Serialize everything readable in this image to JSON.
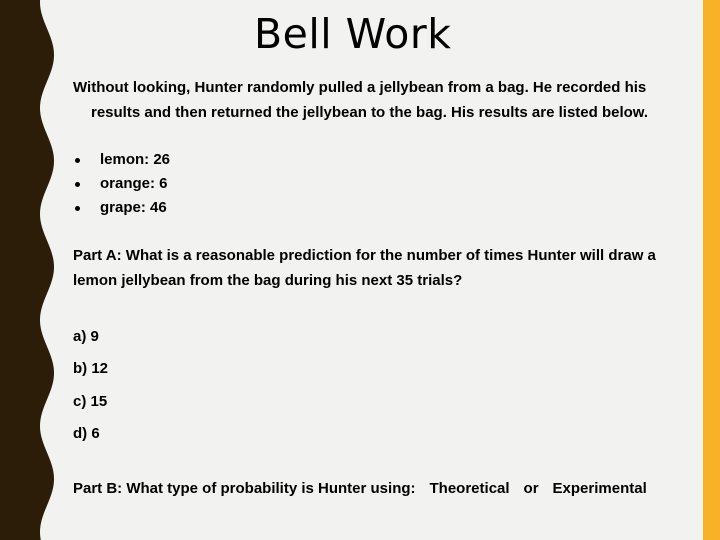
{
  "slide": {
    "title": "Bell Work",
    "colors": {
      "background": "#f2f2f0",
      "left_border": "#2b1d07",
      "right_accent": "#f7b228"
    },
    "intro": {
      "line1": "Without looking, Hunter randomly pulled a jellybean from a bag.  He recorded his",
      "line2": "results and then returned  the jellybean to the bag.  His results are listed below."
    },
    "results": [
      {
        "label": "lemon: 26",
        "flavor": "lemon",
        "count": 26
      },
      {
        "label": "orange: 6",
        "flavor": "orange",
        "count": 6
      },
      {
        "label": "grape: 46",
        "flavor": "grape",
        "count": 46
      }
    ],
    "part_a": {
      "line1": "Part A: What is a reasonable prediction for the number of times Hunter will draw a",
      "line2": "lemon jellybean from the bag during his next 35 trials?"
    },
    "options": [
      {
        "label": "a) 9"
      },
      {
        "label": "b) 12"
      },
      {
        "label": "c) 15"
      },
      {
        "label": "d) 6"
      }
    ],
    "part_b": {
      "question": "Part B: What type of probability is Hunter using:",
      "choice1": "Theoretical",
      "separator": "or",
      "choice2": "Experimental"
    }
  }
}
